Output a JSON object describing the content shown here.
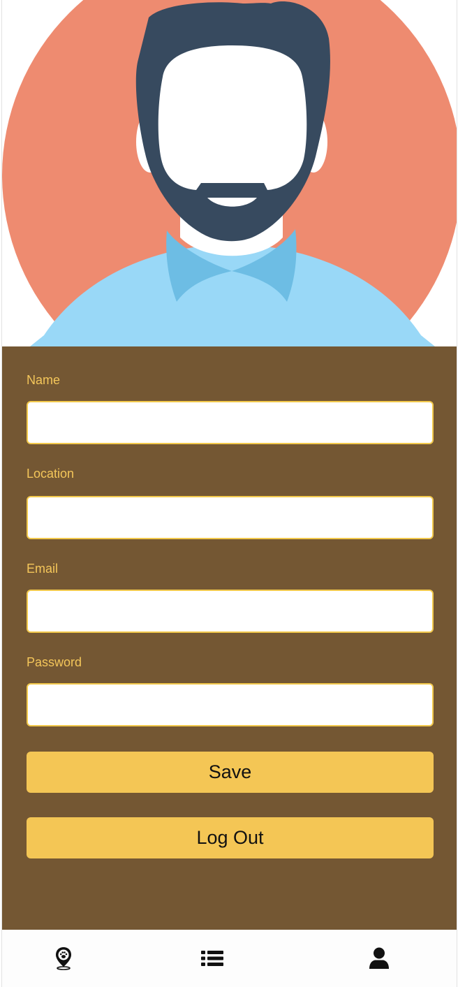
{
  "profile": {
    "avatar_icon": "bearded-man-avatar",
    "colors": {
      "circle": "#ee8b70",
      "hair": "#374a5f",
      "shirt": "#99d8f7",
      "collar": "#6dbde4"
    }
  },
  "form": {
    "background_color": "#745733",
    "label_color": "#f4c65a",
    "fields": [
      {
        "label": "Name",
        "value": "",
        "placeholder": ""
      },
      {
        "label": "Location",
        "value": "",
        "placeholder": ""
      },
      {
        "label": "Email",
        "value": "",
        "placeholder": ""
      },
      {
        "label": "Password",
        "value": "",
        "placeholder": ""
      }
    ],
    "save_label": "Save",
    "logout_label": "Log Out",
    "button_color": "#f4c655"
  },
  "tab_bar": {
    "tabs": [
      {
        "icon": "map-pin-paw-icon"
      },
      {
        "icon": "list-icon"
      },
      {
        "icon": "user-icon"
      }
    ]
  }
}
